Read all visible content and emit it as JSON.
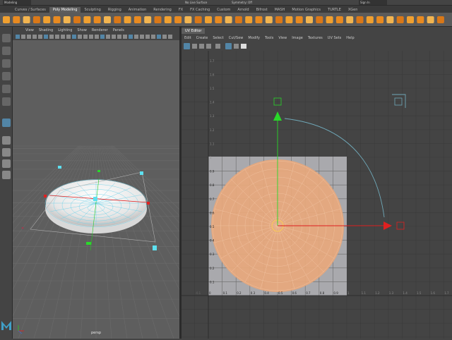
{
  "top": {
    "mode": "Modeling",
    "live_surface": "No Live Surface",
    "symmetry": "Symmetry: Off",
    "signin": "Sign In"
  },
  "shelf_tabs": [
    "Curves / Surfaces",
    "Poly Modeling",
    "Sculpting",
    "Rigging",
    "Animation",
    "Rendering",
    "FX",
    "FX Caching",
    "Custom",
    "Arnold",
    "Bifrost",
    "MASH",
    "Motion Graphics",
    "TURTLE",
    "XGen"
  ],
  "viewport": {
    "menu": [
      "View",
      "Shading",
      "Lighting",
      "Show",
      "Renderer",
      "Panels"
    ],
    "camera_label": "persp"
  },
  "uv_editor": {
    "title": "UV Editor",
    "menu": [
      "Edit",
      "Create",
      "Select",
      "Cut/Sew",
      "Modify",
      "Tools",
      "View",
      "Image",
      "Textures",
      "UV Sets",
      "Help"
    ],
    "axis_u": [
      "0",
      "0.1",
      "0.2",
      "0.3",
      "0.4",
      "0.5",
      "0.6",
      "0.7",
      "0.8",
      "0.9"
    ],
    "axis_v": [
      "0.9",
      "0.8",
      "0.7",
      "0.6",
      "0.5",
      "0.4",
      "0.3",
      "0.2",
      "0.1"
    ],
    "ruler_left": [
      "-1",
      "-0.9",
      "-0.8",
      "-0.7",
      "-0.6",
      "-0.5",
      "-0.4",
      "-0.3",
      "-0.2",
      "-0.1"
    ],
    "ruler_right": [
      "1",
      "1.1",
      "1.2",
      "1.3",
      "1.4",
      "1.5",
      "1.6",
      "1.7",
      "1.8",
      "1.9"
    ],
    "ruler_top": [
      "1.9",
      "1.8",
      "1.7",
      "1.6",
      "1.5",
      "1.4",
      "1.3",
      "1.2",
      "1.1",
      "1"
    ]
  },
  "colors": {
    "accent": "#5285a6",
    "uv_shell": "#e8a87c",
    "move_y": "#29d729",
    "move_x": "#e02020",
    "rotate_arc": "#6fa8b8"
  }
}
